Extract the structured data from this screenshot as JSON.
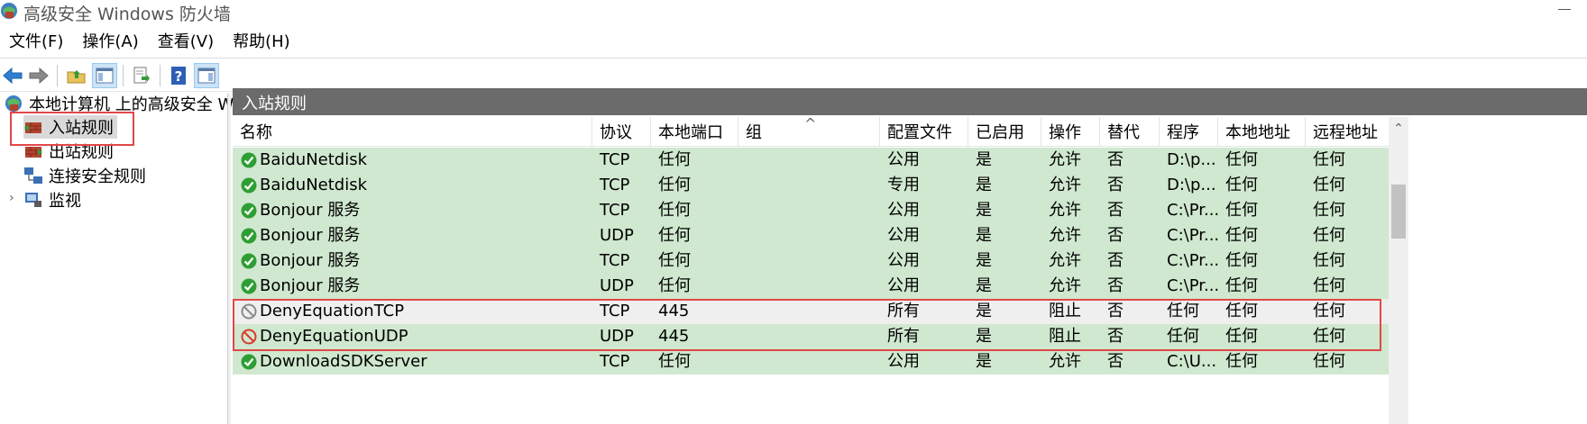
{
  "window": {
    "title": "高级安全 Windows 防火墙"
  },
  "menu": [
    "文件(F)",
    "操作(A)",
    "查看(V)",
    "帮助(H)"
  ],
  "toolbar": {
    "buttons": [
      "back-icon",
      "forward-icon",
      "up-folder-icon",
      "show-hide-tree-icon",
      "export-list-icon",
      "help-icon",
      "show-hide-action-pane-icon"
    ]
  },
  "tree": {
    "root": "本地计算机 上的高级安全 Windows 防火墙",
    "items": [
      "入站规则",
      "出站规则",
      "连接安全规则",
      "监视"
    ]
  },
  "pane": {
    "title": "入站规则"
  },
  "columns": [
    "名称",
    "协议",
    "本地端口",
    "组",
    "配置文件",
    "已启用",
    "操作",
    "替代",
    "程序",
    "本地地址",
    "远程地址"
  ],
  "rows": [
    {
      "status": "allow",
      "cells": [
        "BaiduNetdisk",
        "TCP",
        "任何",
        "",
        "公用",
        "是",
        "允许",
        "否",
        "D:\\p...",
        "任何",
        "任何"
      ]
    },
    {
      "status": "allow",
      "cells": [
        "BaiduNetdisk",
        "TCP",
        "任何",
        "",
        "专用",
        "是",
        "允许",
        "否",
        "D:\\p...",
        "任何",
        "任何"
      ]
    },
    {
      "status": "allow",
      "cells": [
        "Bonjour 服务",
        "TCP",
        "任何",
        "",
        "公用",
        "是",
        "允许",
        "否",
        "C:\\Pr...",
        "任何",
        "任何"
      ]
    },
    {
      "status": "allow",
      "cells": [
        "Bonjour 服务",
        "UDP",
        "任何",
        "",
        "公用",
        "是",
        "允许",
        "否",
        "C:\\Pr...",
        "任何",
        "任何"
      ]
    },
    {
      "status": "allow",
      "cells": [
        "Bonjour 服务",
        "TCP",
        "任何",
        "",
        "公用",
        "是",
        "允许",
        "否",
        "C:\\Pr...",
        "任何",
        "任何"
      ]
    },
    {
      "status": "allow",
      "cells": [
        "Bonjour 服务",
        "UDP",
        "任何",
        "",
        "公用",
        "是",
        "允许",
        "否",
        "C:\\Pr...",
        "任何",
        "任何"
      ]
    },
    {
      "status": "block-disabled",
      "cells": [
        "DenyEquationTCP",
        "TCP",
        "445",
        "",
        "所有",
        "是",
        "阻止",
        "否",
        "任何",
        "任何",
        "任何"
      ]
    },
    {
      "status": "block",
      "cells": [
        "DenyEquationUDP",
        "UDP",
        "445",
        "",
        "所有",
        "是",
        "阻止",
        "否",
        "任何",
        "任何",
        "任何"
      ]
    },
    {
      "status": "allow",
      "cells": [
        "DownloadSDKServer",
        "TCP",
        "任何",
        "",
        "公用",
        "是",
        "允许",
        "否",
        "C:\\U...",
        "任何",
        "任何"
      ]
    }
  ],
  "colors": {
    "allowRow": "#cfe8cf",
    "disabledRow": "#efefef",
    "headerBar": "#6b6b6b",
    "highlight": "#e2474a",
    "allowIcon": "#2e9e34",
    "blockIcon": "#d93b2b"
  }
}
